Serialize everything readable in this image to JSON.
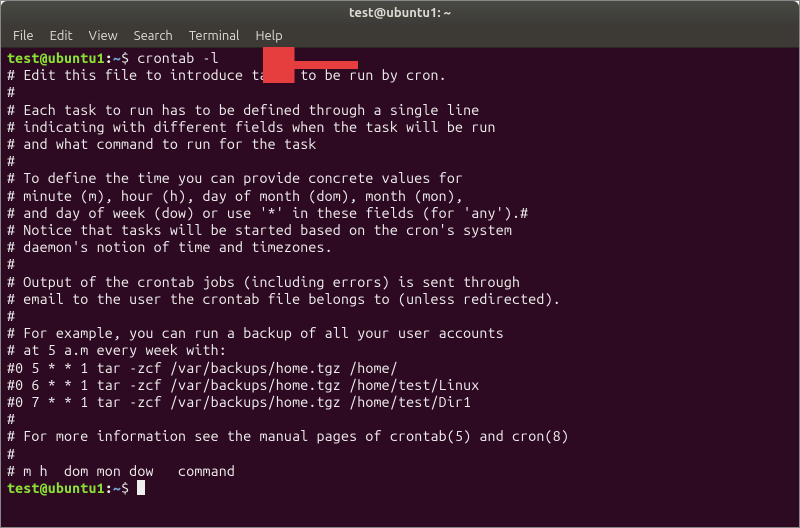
{
  "window": {
    "title": "test@ubuntu1: ~"
  },
  "menu": {
    "items": [
      "File",
      "Edit",
      "View",
      "Search",
      "Terminal",
      "Help"
    ]
  },
  "prompt": {
    "user_host": "test@ubuntu1",
    "colon": ":",
    "path": "~",
    "symbol": "$"
  },
  "command": "crontab -l",
  "output_lines": [
    "# Edit this file to introduce tasks to be run by cron.",
    "#",
    "# Each task to run has to be defined through a single line",
    "# indicating with different fields when the task will be run",
    "# and what command to run for the task",
    "#",
    "# To define the time you can provide concrete values for",
    "# minute (m), hour (h), day of month (dom), month (mon),",
    "# and day of week (dow) or use '*' in these fields (for 'any').#",
    "# Notice that tasks will be started based on the cron's system",
    "# daemon's notion of time and timezones.",
    "#",
    "# Output of the crontab jobs (including errors) is sent through",
    "# email to the user the crontab file belongs to (unless redirected).",
    "#",
    "# For example, you can run a backup of all your user accounts",
    "# at 5 a.m every week with:",
    "#0 5 * * 1 tar -zcf /var/backups/home.tgz /home/",
    "#0 6 * * 1 tar -zcf /var/backups/home.tgz /home/test/Linux",
    "#0 7 * * 1 tar -zcf /var/backups/home.tgz /home/test/Dir1",
    "#",
    "# For more information see the manual pages of crontab(5) and cron(8)",
    "#",
    "# m h  dom mon dow   command"
  ],
  "annotation": {
    "arrow_color": "#e63e3e"
  }
}
